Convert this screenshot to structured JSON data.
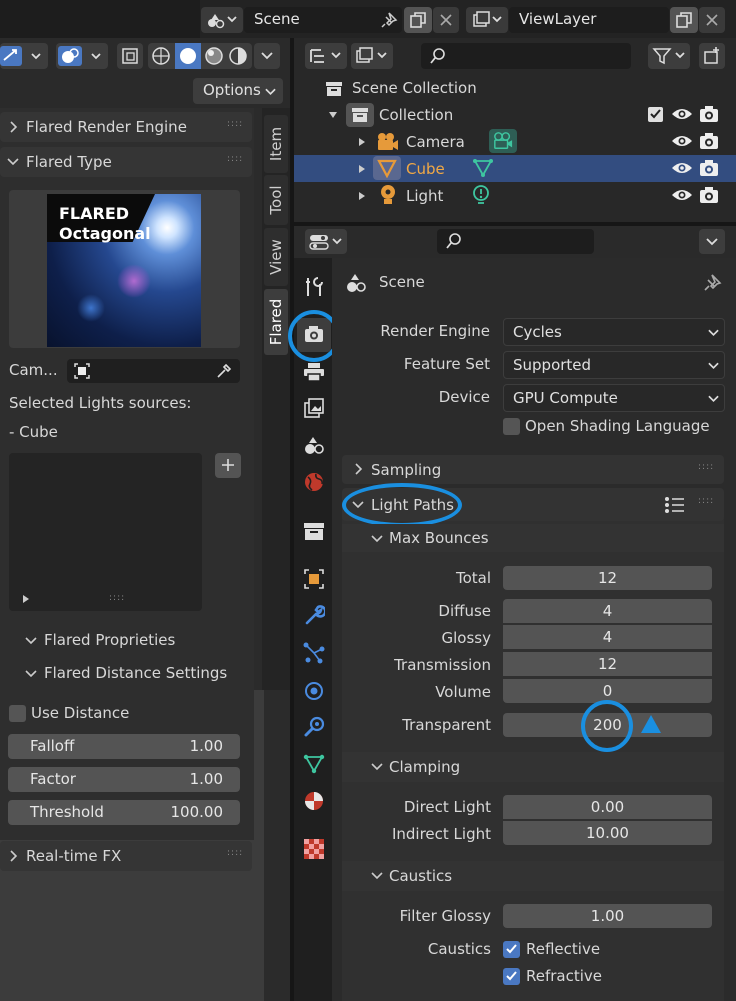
{
  "topbar": {
    "scene_label": "Scene",
    "viewlayer_label": "ViewLayer"
  },
  "left": {
    "options_label": "Options",
    "panels": {
      "flared_render_engine": "Flared Render Engine",
      "flared_type": "Flared Type",
      "flared_proprieties": "Flared Proprieties",
      "flared_distance": "Flared Distance Settings",
      "realtime_fx": "Real-time FX"
    },
    "thumbnail": {
      "line1": "FLARED",
      "line2": "Octagonal"
    },
    "camera_label": "Cam...",
    "selected_lights_label": "Selected Lights sources:",
    "selected_light_item": "- Cube",
    "use_distance_label": "Use Distance",
    "fields": [
      {
        "label": "Falloff",
        "value": "1.00"
      },
      {
        "label": "Factor",
        "value": "1.00"
      },
      {
        "label": "Threshold",
        "value": "100.00"
      }
    ],
    "side_tabs": [
      "Item",
      "Tool",
      "View",
      "Flared"
    ]
  },
  "outliner": {
    "scene_collection": "Scene Collection",
    "collection": "Collection",
    "items": [
      {
        "label": "Camera",
        "selected": false
      },
      {
        "label": "Cube",
        "selected": true
      },
      {
        "label": "Light",
        "selected": false
      }
    ]
  },
  "properties": {
    "scene_title": "Scene",
    "render_engine": {
      "label": "Render Engine",
      "value": "Cycles"
    },
    "feature_set": {
      "label": "Feature Set",
      "value": "Supported"
    },
    "device": {
      "label": "Device",
      "value": "GPU Compute"
    },
    "open_shading_language": "Open Shading Language",
    "sampling": "Sampling",
    "light_paths": "Light Paths",
    "max_bounces": {
      "title": "Max Bounces",
      "total": {
        "label": "Total",
        "value": "12"
      },
      "diffuse": {
        "label": "Diffuse",
        "value": "4"
      },
      "glossy": {
        "label": "Glossy",
        "value": "4"
      },
      "transmission": {
        "label": "Transmission",
        "value": "12"
      },
      "volume": {
        "label": "Volume",
        "value": "0"
      },
      "transparent": {
        "label": "Transparent",
        "value": "200"
      }
    },
    "clamping": {
      "title": "Clamping",
      "direct": {
        "label": "Direct Light",
        "value": "0.00"
      },
      "indirect": {
        "label": "Indirect Light",
        "value": "10.00"
      }
    },
    "caustics": {
      "title": "Caustics",
      "filter_glossy": {
        "label": "Filter Glossy",
        "value": "1.00"
      },
      "caustics_label": "Caustics",
      "reflective": "Reflective",
      "refractive": "Refractive"
    }
  },
  "colors": {
    "accent_blue": "#1a8fe0",
    "selected_row": "#334d80",
    "checkbox_on": "#4a78c2",
    "cube_orange": "#e69a3a",
    "mesh_green": "#3ec6a0"
  }
}
